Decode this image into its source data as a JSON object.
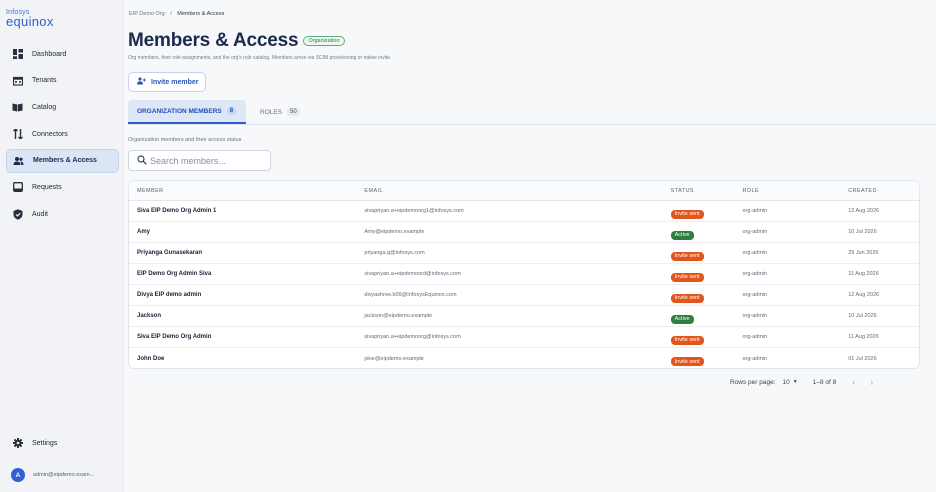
{
  "brand": {
    "line1": "Infosys",
    "line2": "equinox"
  },
  "sidebar": {
    "items": [
      {
        "label": "Dashboard",
        "icon": "dashboard-icon"
      },
      {
        "label": "Tenants",
        "icon": "tenants-icon"
      },
      {
        "label": "Catalog",
        "icon": "catalog-icon"
      },
      {
        "label": "Connectors",
        "icon": "connectors-icon"
      },
      {
        "label": "Members & Access",
        "icon": "members-icon",
        "active": true
      },
      {
        "label": "Requests",
        "icon": "requests-icon"
      },
      {
        "label": "Audit",
        "icon": "audit-shield-icon"
      }
    ],
    "settings_label": "Settings",
    "user": {
      "initial": "A",
      "email": "admin@eipdemo.exam..."
    }
  },
  "breadcrumb": {
    "parent": "EIP Demo Org",
    "separator": "/",
    "current": "Members & Access"
  },
  "page": {
    "title": "Members & Access",
    "scope_badge": "Organization",
    "subtitle": "Org members, their role assignments, and the org's role catalog. Members arrive via SCIM provisioning or native invite.",
    "invite_button": "Invite member"
  },
  "tabs": {
    "members": {
      "label": "ORGANIZATION MEMBERS",
      "count": "8"
    },
    "roles": {
      "label": "ROLES",
      "count": "50"
    }
  },
  "members_section": {
    "description": "Organization members and their access status",
    "search_placeholder": "Search members..."
  },
  "table": {
    "headers": {
      "member": "MEMBER",
      "email": "EMAIL",
      "status": "STATUS",
      "role": "ROLE",
      "created": "CREATED"
    },
    "rows": [
      {
        "member": "Siva EIP Demo Org Admin 1",
        "email": "sivapriyan.a+eipdemoorg1@infosys.com",
        "status": "Invite sent",
        "role": "org-admin",
        "created": "12 Aug 2026"
      },
      {
        "member": "Amy",
        "email": "Amy@eipdemo.example",
        "status": "Active",
        "role": "org-admin",
        "created": "10 Jul 2026"
      },
      {
        "member": "Priyanga Gunasekaran",
        "email": "priyanga.g@infosys.com",
        "status": "Invite sent",
        "role": "org-admin",
        "created": "29 Jun 2026"
      },
      {
        "member": "EIP Demo Org Admin Siva",
        "email": "sivapriyan.a+eipdemoord@infosys.com",
        "status": "Invite sent",
        "role": "org-admin",
        "created": "11 Aug 2026"
      },
      {
        "member": "Divya EIP demo admin",
        "email": "divyashree.b09@InfosysEquinox.com",
        "status": "Invite sent",
        "role": "org-admin",
        "created": "12 Aug 2026"
      },
      {
        "member": "Jackson",
        "email": "jackson@eipdemo.example",
        "status": "Active",
        "role": "org-admin",
        "created": "10 Jul 2026"
      },
      {
        "member": "Siva EIP Demo Org Admin",
        "email": "sivapriyan.a+eipdemoorg@infosys.com",
        "status": "Invite sent",
        "role": "org-admin",
        "created": "11 Aug 2026"
      },
      {
        "member": "John Doe",
        "email": "jdoe@eipdemo.example",
        "status": "Invite sent",
        "role": "org-admin",
        "created": "01 Jul 2026"
      }
    ]
  },
  "status_colors": {
    "Invite sent": "#e2551c",
    "Active": "#2f7d3f"
  },
  "pagination": {
    "rows_per_page_label": "Rows per page:",
    "rows_per_page": "10",
    "range": "1–8 of 8",
    "prev_icon": "chevron-left-icon",
    "next_icon": "chevron-right-icon"
  }
}
